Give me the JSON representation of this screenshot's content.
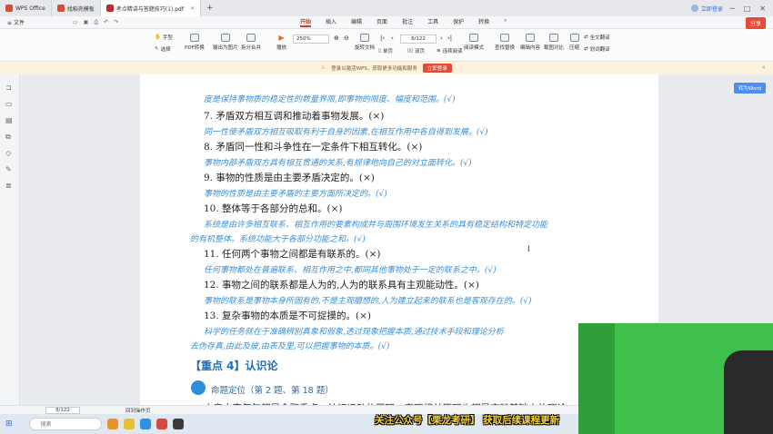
{
  "tabs": [
    {
      "label": "WPS Office",
      "color": "#d84a3b"
    },
    {
      "label": "找稻壳模板",
      "color": "#d84a3b"
    },
    {
      "label": "考点精讲与答题技巧(1).pdf",
      "color": "#c62828"
    }
  ],
  "login_label": "立即登录",
  "file_label": "文件",
  "menus": [
    "开始",
    "插入",
    "编辑",
    "页面",
    "批注",
    "工具",
    "保护",
    "转换"
  ],
  "active_menu": "开始",
  "share_label": "分享",
  "ribbon": {
    "hand": "手型",
    "select": "选择",
    "pdf_convert": "PDF转换",
    "output_image": "输出为图片",
    "split_merge": "拆分合并",
    "play": "播放",
    "zoom": "250%",
    "rotate": "旋转文档",
    "single": "单页",
    "double": "双页",
    "continuous": "连续阅读",
    "page_value": "8/122",
    "read_mode": "阅读模式",
    "find_replace": "查找替换",
    "edit_content": "编辑内容",
    "crop": "截图对比",
    "compress": "压缩",
    "full_translate": "全文翻译",
    "trans": "划词翻译"
  },
  "notice": {
    "text": "登录以激活WPS，获取更多功能和服务",
    "button": "立即登录"
  },
  "to_word_label": "转为Word",
  "content": {
    "l1": "度是保持事物质的稳定性的数量界限,即事物的限度、幅度和范围。(√)",
    "l2": "7. 矛盾双方相互调和推动着事物发展。(×)",
    "l3": "同一性使矛盾双方相互吸取有利于自身的因素,在相互作用中各自得到发展。(√)",
    "l4": "8. 矛盾同一性和斗争性在一定条件下相互转化。(×)",
    "l5": "事物内部矛盾双方具有相互贯通的关系,有规律地向自己的对立面转化。(√)",
    "l6": "9. 事物的性质是由主要矛盾决定的。(×)",
    "l7": "事物的性质是由主要矛盾的主要方面所决定的。(√)",
    "l8": "10. 整体等于各部分的总和。(×)",
    "l9": "系统是由许多相互联系、相互作用的要素构成并与周围环境发生关系的具有稳定结构和特定功能",
    "l10": "的有机整体。系统功能大于各部分功能之和。(√)",
    "l11": "11. 任何两个事物之间都是有联系的。(×)",
    "l12": "任何事物都处在普遍联系、相互作用之中,都同其他事物处于一定的联系之中。(√)",
    "l13": "12. 事物之间的联系都是人为的,人为的联系具有主观能动性。(×)",
    "l14": "事物的联系是事物本身所固有的,不是主观臆想的,人为建立起来的联系也是客观存在的。(√)",
    "l15": "13. 复杂事物的本质是不可捉摸的。(×)",
    "l16": "科学的任务就在于准确辨别真象和假象,透过现象把握本质,通过技术手段和理论分析",
    "l17": "去伪存真,由此及彼,由表及里,可以把握事物的本质。(√)",
    "h1": "【重点 4】认识论",
    "pos": "命题定位（第 2 题、第 18 题）",
    "l18": "本章内容每年都是命题重点，认识运动的原理，真理相关原理也都是实践基础上的理论"
  },
  "status": {
    "page": "8/122",
    "return": "回到操作页"
  },
  "taskbar": {
    "search": "搜索"
  },
  "banner": "关注公众号【栗龙考研】 获取后续课程更新"
}
